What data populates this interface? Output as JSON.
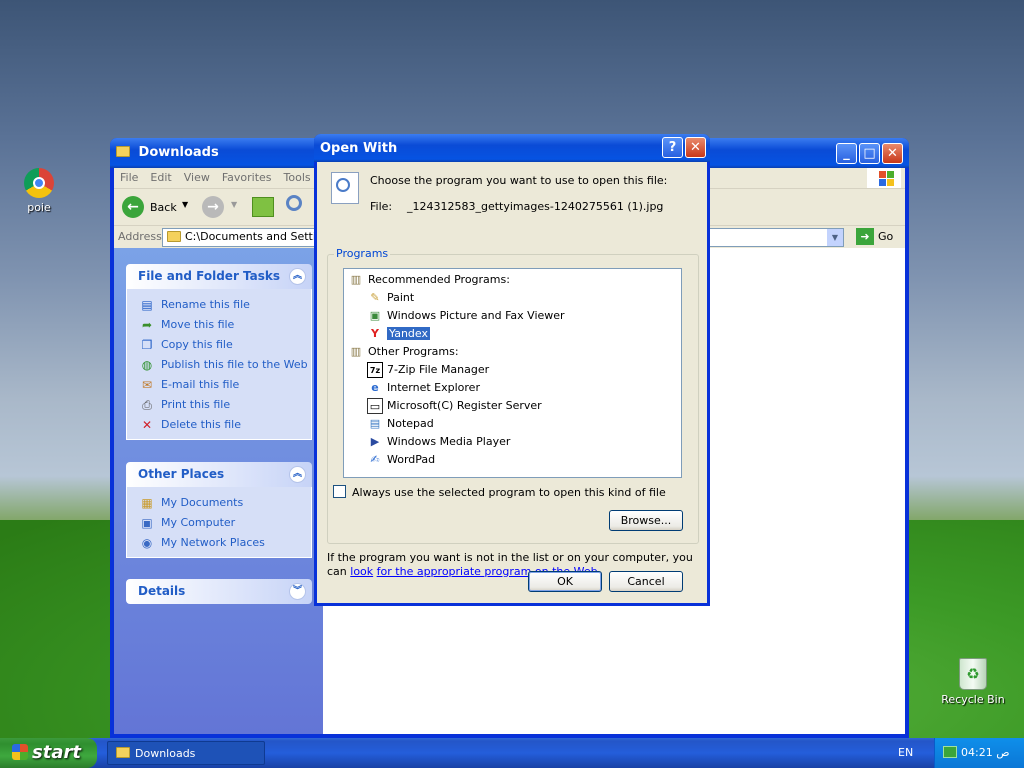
{
  "desktop": {
    "icons": [
      {
        "label": "poie"
      },
      {
        "label": "Recycle Bin"
      }
    ]
  },
  "explorer": {
    "title": "Downloads",
    "menu": [
      "File",
      "Edit",
      "View",
      "Favorites",
      "Tools"
    ],
    "toolbar": {
      "back_label": "Back"
    },
    "address": {
      "label": "Address",
      "value": "C:\\Documents and Settings",
      "go_label": "Go"
    },
    "file_tasks": {
      "title": "File and Folder Tasks",
      "items": [
        "Rename this file",
        "Move this file",
        "Copy this file",
        "Publish this file to the Web",
        "E-mail this file",
        "Print this file",
        "Delete this file"
      ]
    },
    "other_places": {
      "title": "Other Places",
      "items": [
        "My Documents",
        "My Computer",
        "My Network Places"
      ]
    },
    "details": {
      "title": "Details"
    }
  },
  "dialog": {
    "title": "Open With",
    "instruction": "Choose the program you want to use to open this file:",
    "file_label": "File:",
    "file_name": "_124312583_gettyimages-1240275561 (1).jpg",
    "group_label": "Programs",
    "recommended_header": "Recommended Programs:",
    "recommended": [
      "Paint",
      "Windows Picture and Fax Viewer",
      "Yandex"
    ],
    "other_header": "Other Programs:",
    "other": [
      "7-Zip File Manager",
      "Internet Explorer",
      "Microsoft(C) Register Server",
      "Notepad",
      "Windows Media Player",
      "WordPad"
    ],
    "selected": "Yandex",
    "always_use_label": "Always use the selected program to open this kind of file",
    "always_use_checked": false,
    "browse_label": "Browse...",
    "footer_text": "If the program you want is not in the list or on your computer, you can",
    "footer_link_1": "look",
    "footer_link_2": "for the appropriate program on the Web",
    "ok_label": "OK",
    "cancel_label": "Cancel"
  },
  "taskbar": {
    "start_label": "start",
    "task_label": "Downloads",
    "language": "EN",
    "clock": "04:21 ص"
  },
  "colors": {
    "accent": "#0831d9",
    "link": "#215dc6",
    "selection": "#316ac5"
  }
}
